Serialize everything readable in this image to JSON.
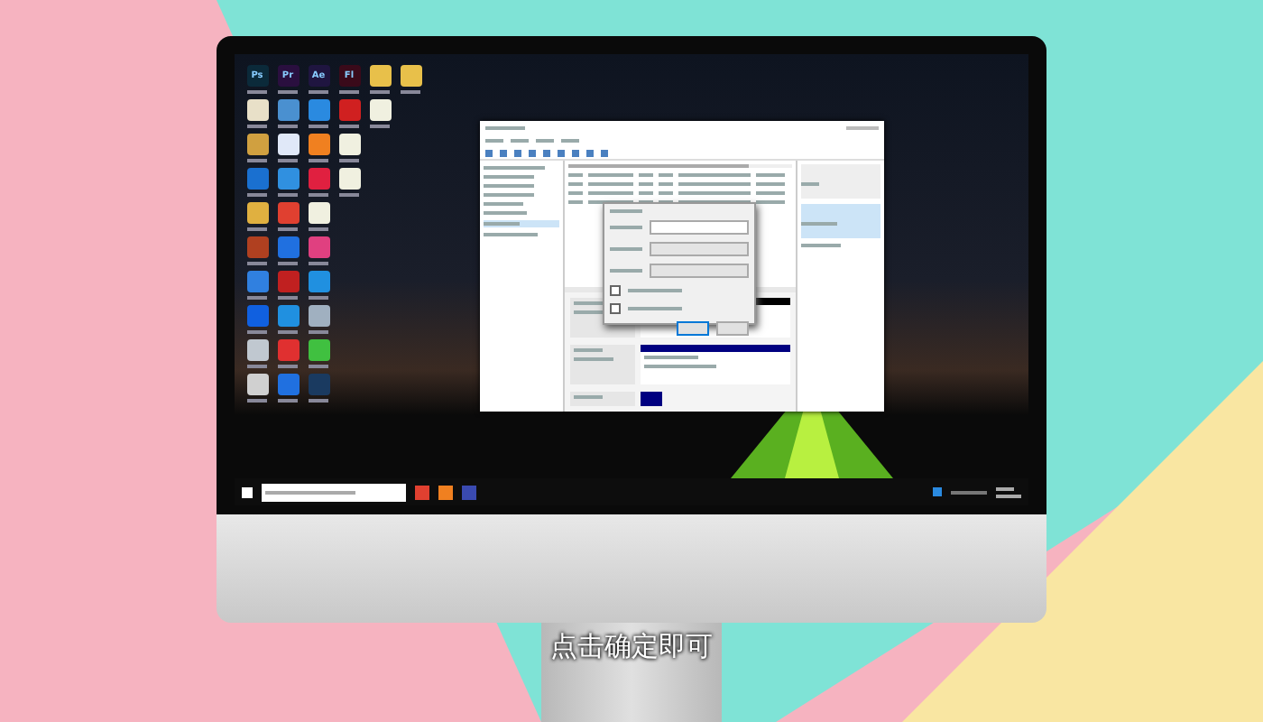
{
  "caption": "点击确定即可",
  "desktop_icon_rows": [
    [
      {
        "glyph": "Ps",
        "color": "#0b2a3a"
      },
      {
        "glyph": "Pr",
        "color": "#2a0f3f"
      },
      {
        "glyph": "Ae",
        "color": "#1f1540"
      },
      {
        "glyph": "Fl",
        "color": "#3a0a1a"
      },
      {
        "color": "#e8c04a"
      },
      {
        "color": "#e8c04a"
      }
    ],
    [
      {
        "color": "#e8e0c8"
      },
      {
        "color": "#4a90d0"
      },
      {
        "color": "#2a8ae0"
      },
      {
        "color": "#d02020"
      },
      {
        "color": "#f0f0e0"
      }
    ],
    [
      {
        "color": "#d0a040"
      },
      {
        "color": "#e0e8f8"
      },
      {
        "color": "#f08020"
      },
      {
        "color": "#f0f0e0"
      }
    ],
    [
      {
        "color": "#1a70d0"
      },
      {
        "color": "#3090e0"
      },
      {
        "color": "#e02040"
      },
      {
        "color": "#f0f0e0"
      }
    ],
    [
      {
        "color": "#e0b040"
      },
      {
        "color": "#e04030"
      },
      {
        "color": "#f0f0e0"
      }
    ],
    [
      {
        "color": "#b04020"
      },
      {
        "color": "#2070e0"
      },
      {
        "color": "#e04080"
      }
    ],
    [
      {
        "color": "#3080e0"
      },
      {
        "color": "#c02020"
      },
      {
        "color": "#2090e0"
      }
    ],
    [
      {
        "color": "#1060e0"
      },
      {
        "color": "#2090e0"
      },
      {
        "color": "#a0b0c0"
      }
    ],
    [
      {
        "color": "#c0c8d0"
      },
      {
        "color": "#e03030"
      },
      {
        "color": "#40c040"
      }
    ],
    [
      {
        "color": "#d0d0d0"
      },
      {
        "color": "#2070e0"
      },
      {
        "color": "#1a3a60"
      }
    ]
  ],
  "taskbar_apps": [
    {
      "color": "#e04030"
    },
    {
      "color": "#f08020"
    },
    {
      "color": "#3a4ab0"
    }
  ],
  "dialog": {
    "checkboxes": [
      {
        "checked": false
      },
      {
        "checked": false
      }
    ]
  }
}
